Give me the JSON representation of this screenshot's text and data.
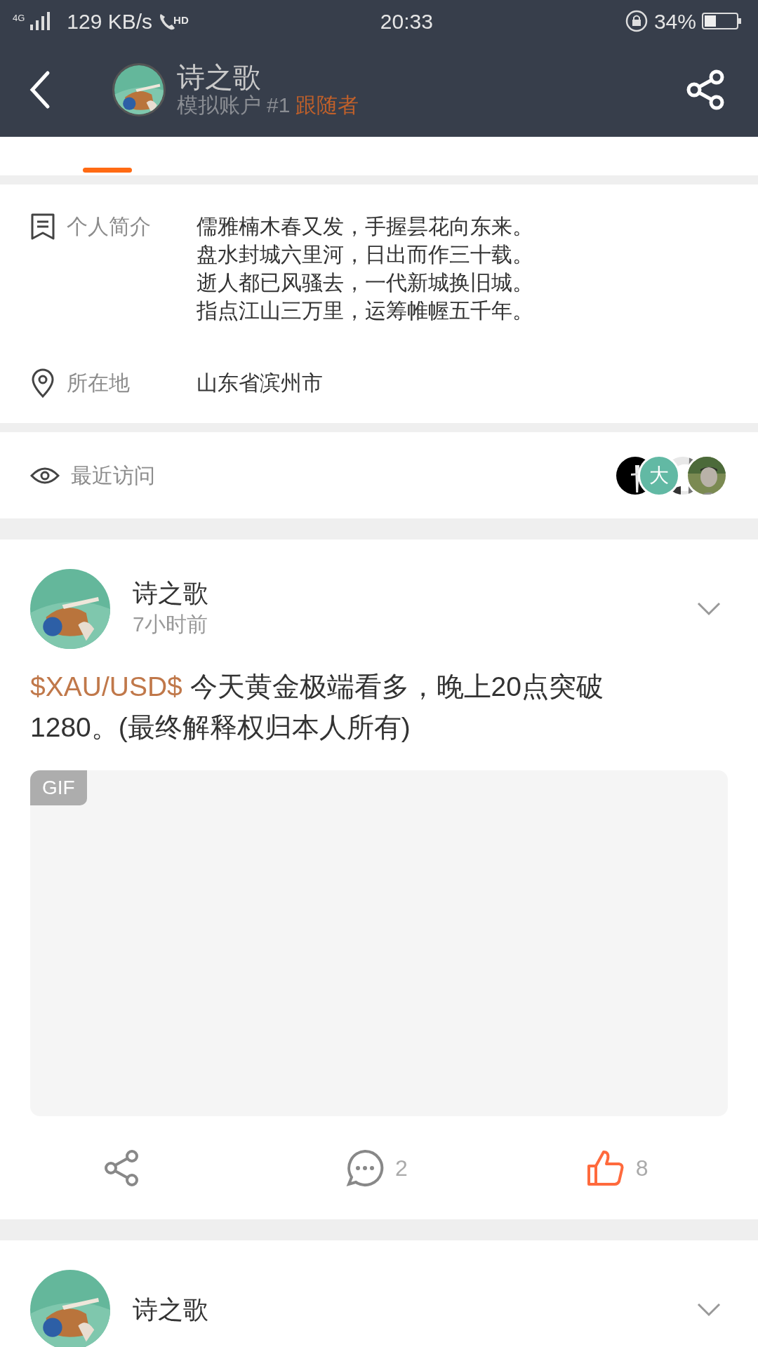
{
  "status_bar": {
    "network": "4G",
    "speed": "129 KB/s",
    "call": "HD",
    "time": "20:33",
    "battery": "34%"
  },
  "header": {
    "name": "诗之歌",
    "account": "模拟账户",
    "rank": "#1",
    "role": "跟随者"
  },
  "tabs": [
    {
      "selected": true
    }
  ],
  "profile": {
    "intro_label": "个人简介",
    "intro_lines": [
      "儒雅楠木春又发，手握昙花向东来。",
      "盘水封城六里河，日出而作三十载。",
      "逝人都已风骚去，一代新城换旧城。",
      "指点江山三万里，运筹帷幄五千年。"
    ],
    "location_label": "所在地",
    "location": "山东省滨州市"
  },
  "recent_visits": {
    "label": "最近访问",
    "visitors": [
      {
        "kind": "picture"
      },
      {
        "kind": "letter",
        "text": "大"
      },
      {
        "kind": "picture"
      },
      {
        "kind": "picture"
      }
    ]
  },
  "posts": [
    {
      "author": "诗之歌",
      "time": "7小时前",
      "tag": "$XAU/USD$",
      "body": "今天黄金极端看多，晚上20点突破1280。(最终解释权归本人所有)",
      "media_badge": "GIF",
      "comments": "2",
      "likes": "8",
      "liked": true
    },
    {
      "author": "诗之歌"
    }
  ]
}
